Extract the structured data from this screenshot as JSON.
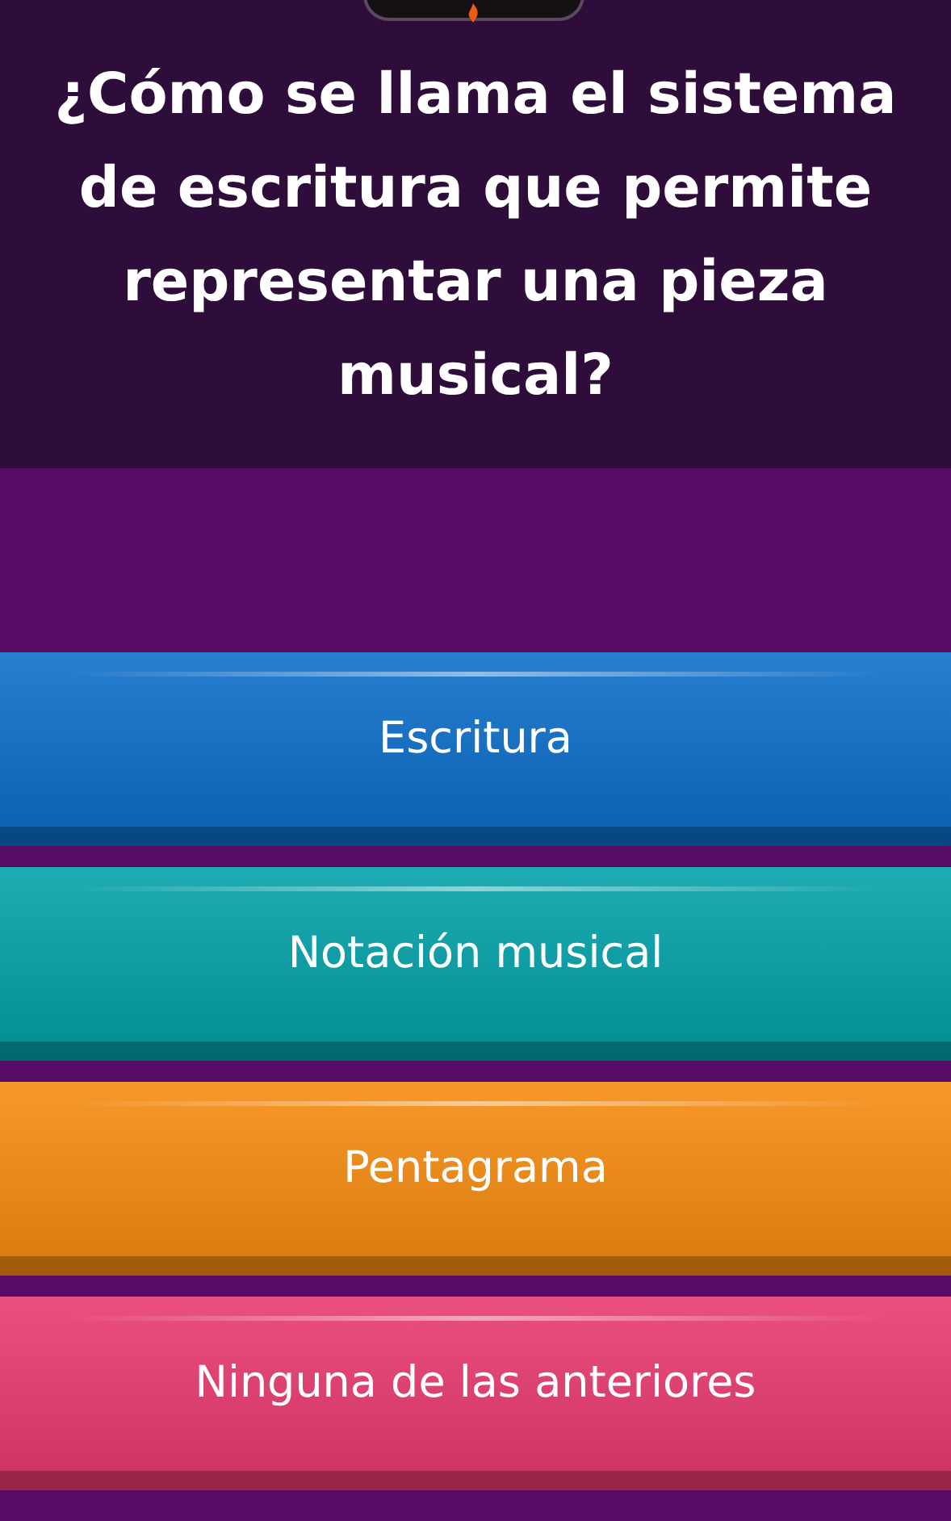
{
  "question": "¿Cómo se llama el sistema de escritura que permite representar una pieza musical?",
  "answers": [
    {
      "label": "Escritura",
      "color": "#0a6cc8"
    },
    {
      "label": "Notación musical",
      "color": "#00a0a8"
    },
    {
      "label": "Pentagrama",
      "color": "#f68a0e"
    },
    {
      "label": "Ninguna de las anteriores",
      "color": "#e8386e"
    }
  ]
}
